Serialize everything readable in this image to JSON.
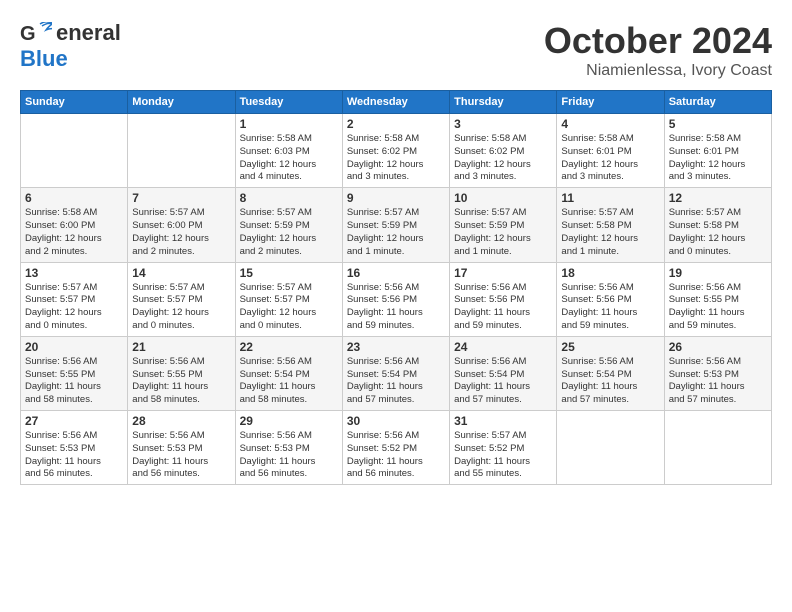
{
  "header": {
    "logo_general": "General",
    "logo_blue": "Blue",
    "month_title": "October 2024",
    "location": "Niamienlessa, Ivory Coast"
  },
  "calendar": {
    "days_of_week": [
      "Sunday",
      "Monday",
      "Tuesday",
      "Wednesday",
      "Thursday",
      "Friday",
      "Saturday"
    ],
    "weeks": [
      [
        {
          "day": "",
          "info": ""
        },
        {
          "day": "",
          "info": ""
        },
        {
          "day": "1",
          "info": "Sunrise: 5:58 AM\nSunset: 6:03 PM\nDaylight: 12 hours\nand 4 minutes."
        },
        {
          "day": "2",
          "info": "Sunrise: 5:58 AM\nSunset: 6:02 PM\nDaylight: 12 hours\nand 3 minutes."
        },
        {
          "day": "3",
          "info": "Sunrise: 5:58 AM\nSunset: 6:02 PM\nDaylight: 12 hours\nand 3 minutes."
        },
        {
          "day": "4",
          "info": "Sunrise: 5:58 AM\nSunset: 6:01 PM\nDaylight: 12 hours\nand 3 minutes."
        },
        {
          "day": "5",
          "info": "Sunrise: 5:58 AM\nSunset: 6:01 PM\nDaylight: 12 hours\nand 3 minutes."
        }
      ],
      [
        {
          "day": "6",
          "info": "Sunrise: 5:58 AM\nSunset: 6:00 PM\nDaylight: 12 hours\nand 2 minutes."
        },
        {
          "day": "7",
          "info": "Sunrise: 5:57 AM\nSunset: 6:00 PM\nDaylight: 12 hours\nand 2 minutes."
        },
        {
          "day": "8",
          "info": "Sunrise: 5:57 AM\nSunset: 5:59 PM\nDaylight: 12 hours\nand 2 minutes."
        },
        {
          "day": "9",
          "info": "Sunrise: 5:57 AM\nSunset: 5:59 PM\nDaylight: 12 hours\nand 1 minute."
        },
        {
          "day": "10",
          "info": "Sunrise: 5:57 AM\nSunset: 5:59 PM\nDaylight: 12 hours\nand 1 minute."
        },
        {
          "day": "11",
          "info": "Sunrise: 5:57 AM\nSunset: 5:58 PM\nDaylight: 12 hours\nand 1 minute."
        },
        {
          "day": "12",
          "info": "Sunrise: 5:57 AM\nSunset: 5:58 PM\nDaylight: 12 hours\nand 0 minutes."
        }
      ],
      [
        {
          "day": "13",
          "info": "Sunrise: 5:57 AM\nSunset: 5:57 PM\nDaylight: 12 hours\nand 0 minutes."
        },
        {
          "day": "14",
          "info": "Sunrise: 5:57 AM\nSunset: 5:57 PM\nDaylight: 12 hours\nand 0 minutes."
        },
        {
          "day": "15",
          "info": "Sunrise: 5:57 AM\nSunset: 5:57 PM\nDaylight: 12 hours\nand 0 minutes."
        },
        {
          "day": "16",
          "info": "Sunrise: 5:56 AM\nSunset: 5:56 PM\nDaylight: 11 hours\nand 59 minutes."
        },
        {
          "day": "17",
          "info": "Sunrise: 5:56 AM\nSunset: 5:56 PM\nDaylight: 11 hours\nand 59 minutes."
        },
        {
          "day": "18",
          "info": "Sunrise: 5:56 AM\nSunset: 5:56 PM\nDaylight: 11 hours\nand 59 minutes."
        },
        {
          "day": "19",
          "info": "Sunrise: 5:56 AM\nSunset: 5:55 PM\nDaylight: 11 hours\nand 59 minutes."
        }
      ],
      [
        {
          "day": "20",
          "info": "Sunrise: 5:56 AM\nSunset: 5:55 PM\nDaylight: 11 hours\nand 58 minutes."
        },
        {
          "day": "21",
          "info": "Sunrise: 5:56 AM\nSunset: 5:55 PM\nDaylight: 11 hours\nand 58 minutes."
        },
        {
          "day": "22",
          "info": "Sunrise: 5:56 AM\nSunset: 5:54 PM\nDaylight: 11 hours\nand 58 minutes."
        },
        {
          "day": "23",
          "info": "Sunrise: 5:56 AM\nSunset: 5:54 PM\nDaylight: 11 hours\nand 57 minutes."
        },
        {
          "day": "24",
          "info": "Sunrise: 5:56 AM\nSunset: 5:54 PM\nDaylight: 11 hours\nand 57 minutes."
        },
        {
          "day": "25",
          "info": "Sunrise: 5:56 AM\nSunset: 5:54 PM\nDaylight: 11 hours\nand 57 minutes."
        },
        {
          "day": "26",
          "info": "Sunrise: 5:56 AM\nSunset: 5:53 PM\nDaylight: 11 hours\nand 57 minutes."
        }
      ],
      [
        {
          "day": "27",
          "info": "Sunrise: 5:56 AM\nSunset: 5:53 PM\nDaylight: 11 hours\nand 56 minutes."
        },
        {
          "day": "28",
          "info": "Sunrise: 5:56 AM\nSunset: 5:53 PM\nDaylight: 11 hours\nand 56 minutes."
        },
        {
          "day": "29",
          "info": "Sunrise: 5:56 AM\nSunset: 5:53 PM\nDaylight: 11 hours\nand 56 minutes."
        },
        {
          "day": "30",
          "info": "Sunrise: 5:56 AM\nSunset: 5:52 PM\nDaylight: 11 hours\nand 56 minutes."
        },
        {
          "day": "31",
          "info": "Sunrise: 5:57 AM\nSunset: 5:52 PM\nDaylight: 11 hours\nand 55 minutes."
        },
        {
          "day": "",
          "info": ""
        },
        {
          "day": "",
          "info": ""
        }
      ]
    ]
  }
}
